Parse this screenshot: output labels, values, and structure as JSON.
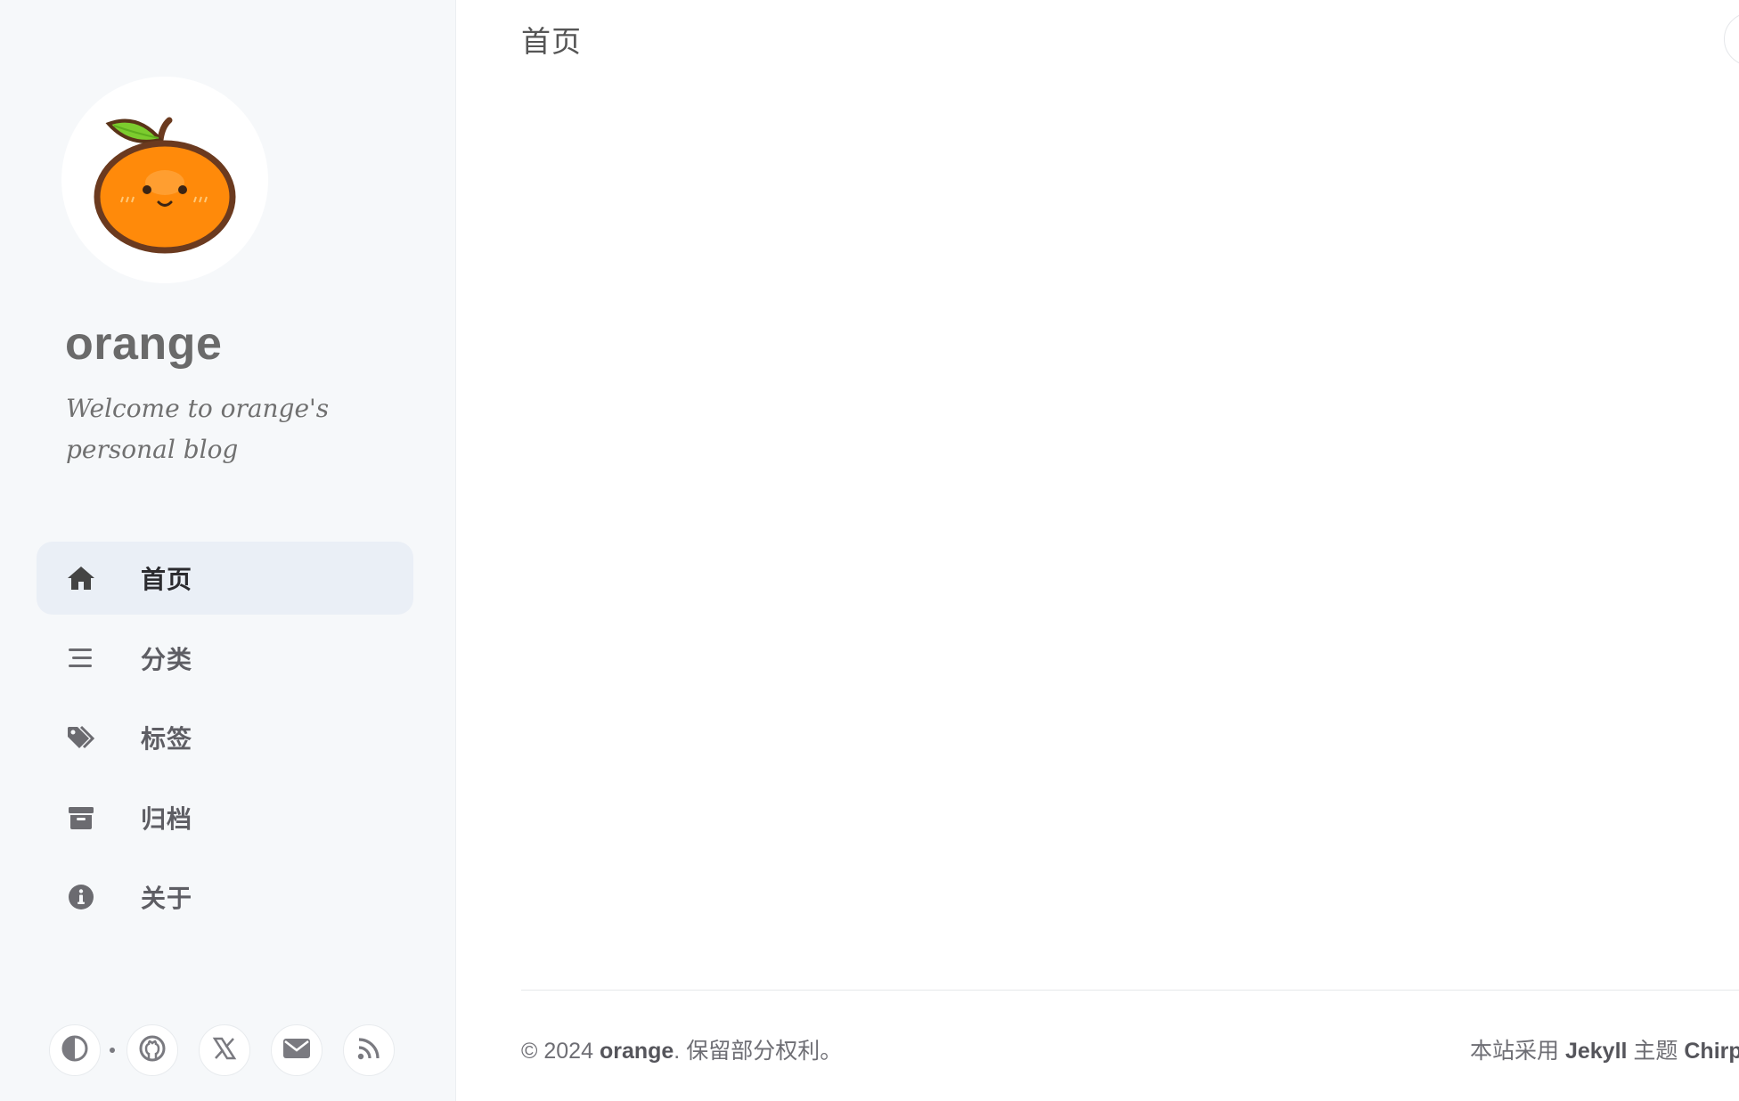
{
  "sidebar": {
    "site_title": "orange",
    "site_subtitle": "Welcome to orange's personal blog",
    "nav": [
      {
        "label": "首页",
        "icon": "home-icon",
        "active": true
      },
      {
        "label": "分类",
        "icon": "stream-icon",
        "active": false
      },
      {
        "label": "标签",
        "icon": "tags-icon",
        "active": false
      },
      {
        "label": "归档",
        "icon": "archive-icon",
        "active": false
      },
      {
        "label": "关于",
        "icon": "info-icon",
        "active": false
      }
    ],
    "bottom_icons": [
      "theme-toggle-icon",
      "github-icon",
      "x-icon",
      "email-icon",
      "rss-icon"
    ]
  },
  "topbar": {
    "breadcrumb": "首页"
  },
  "footer": {
    "copyright_prefix": "© 2024 ",
    "copyright_owner": "orange",
    "copyright_suffix": ". 保留部分权利。",
    "powered_prefix": "本站采用 ",
    "powered_jekyll": "Jekyll",
    "powered_mid": " 主题 ",
    "powered_theme": "Chirpy"
  },
  "colors": {
    "sidebar_bg": "#f6f8fa",
    "active_nav_bg": "#eaeff6",
    "orange": "#ff8a0a"
  }
}
